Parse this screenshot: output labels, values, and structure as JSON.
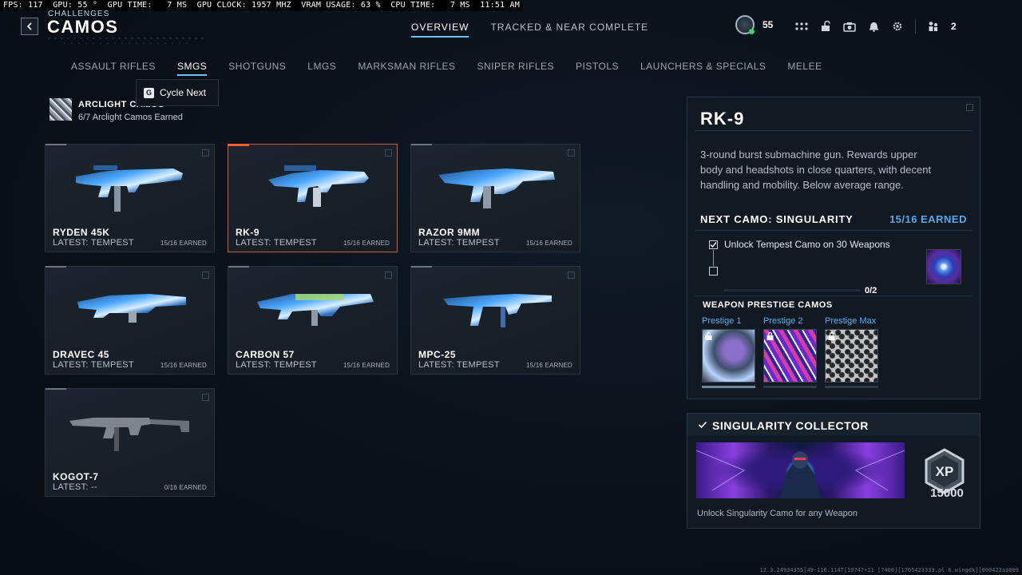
{
  "perf_overlay": "FPS: 117  GPU: 55 °  GPU TIME:   7 MS  GPU CLOCK: 1957 MHZ  VRAM USAGE: 63 %  CPU TIME:   7 MS  11:51 AM",
  "header": {
    "breadcrumb": "CHALLENGES",
    "title": "CAMOS",
    "tabs": [
      {
        "label": "OVERVIEW",
        "active": true
      },
      {
        "label": "TRACKED & NEAR COMPLETE",
        "active": false
      }
    ],
    "player_level": "55",
    "party_count": "2",
    "icons": [
      "grid-menu-icon",
      "unlock-icon",
      "camera-icon",
      "bell-icon",
      "gear-icon",
      "party-icon"
    ]
  },
  "categories": [
    {
      "label": "ASSAULT RIFLES",
      "active": false
    },
    {
      "label": "SMGS",
      "active": true
    },
    {
      "label": "SHOTGUNS",
      "active": false
    },
    {
      "label": "LMGS",
      "active": false
    },
    {
      "label": "MARKSMAN RIFLES",
      "active": false
    },
    {
      "label": "SNIPER RIFLES",
      "active": false
    },
    {
      "label": "PISTOLS",
      "active": false
    },
    {
      "label": "LAUNCHERS & SPECIALS",
      "active": false
    },
    {
      "label": "MELEE",
      "active": false
    }
  ],
  "tooltip": {
    "key": "G",
    "label": "Cycle Next"
  },
  "arclight": {
    "title": "ARCLIGHT CAMOS",
    "subtitle": "6/7 Arclight Camos Earned"
  },
  "weapons": [
    {
      "name": "RYDEN 45K",
      "latest": "LATEST: TEMPEST",
      "earned": "15/16 EARNED",
      "camo": "tempest"
    },
    {
      "name": "RK-9",
      "latest": "LATEST: TEMPEST",
      "earned": "15/16 EARNED",
      "camo": "tempest",
      "selected": true
    },
    {
      "name": "RAZOR 9MM",
      "latest": "LATEST: TEMPEST",
      "earned": "15/16 EARNED",
      "camo": "tempest"
    },
    {
      "name": "DRAVEC 45",
      "latest": "LATEST: TEMPEST",
      "earned": "15/16 EARNED",
      "camo": "tempest"
    },
    {
      "name": "CARBON 57",
      "latest": "LATEST: TEMPEST",
      "earned": "15/16 EARNED",
      "camo": "tempest"
    },
    {
      "name": "MPC-25",
      "latest": "LATEST: TEMPEST",
      "earned": "15/16 EARNED",
      "camo": "tempest"
    },
    {
      "name": "KOGOT-7",
      "latest": "LATEST: --",
      "earned": "0/16 EARNED",
      "camo": "none"
    }
  ],
  "detail": {
    "name": "RK-9",
    "description": "3-round burst submachine gun. Rewards upper body and headshots in close quarters, with decent handling and mobility. Below average range.",
    "next_camo": "NEXT CAMO: SINGULARITY",
    "next_earned": "15/16 EARNED",
    "requirement": "Unlock Tempest Camo on 30 Weapons",
    "requirement_progress": "0/2",
    "prestige_title": "WEAPON PRESTIGE CAMOS",
    "prestige": [
      {
        "label": "Prestige 1"
      },
      {
        "label": "Prestige 2"
      },
      {
        "label": "Prestige Max"
      }
    ]
  },
  "collector": {
    "title": "SINGULARITY COLLECTOR",
    "xp_label": "XP",
    "xp_value": "15000",
    "description": "Unlock Singularity Camo for any Weapon"
  },
  "build_string": "12.3.24934355[49-116.114T[10747+11 [7400][1765423333.pl 6.wingdk][000422a3000"
}
